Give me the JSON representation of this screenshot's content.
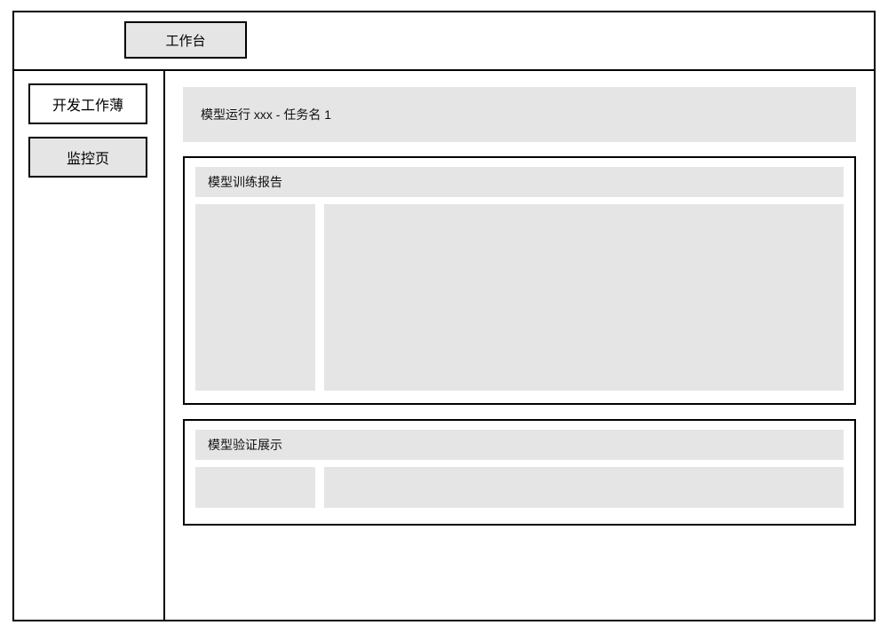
{
  "header": {
    "tab_label": "工作台"
  },
  "sidebar": {
    "items": [
      {
        "label": "开发工作薄",
        "active": false
      },
      {
        "label": "监控页",
        "active": true
      }
    ]
  },
  "main": {
    "title": "模型运行 xxx - 任务名 1",
    "panels": [
      {
        "title": "模型训练报告"
      },
      {
        "title": "模型验证展示"
      }
    ]
  }
}
